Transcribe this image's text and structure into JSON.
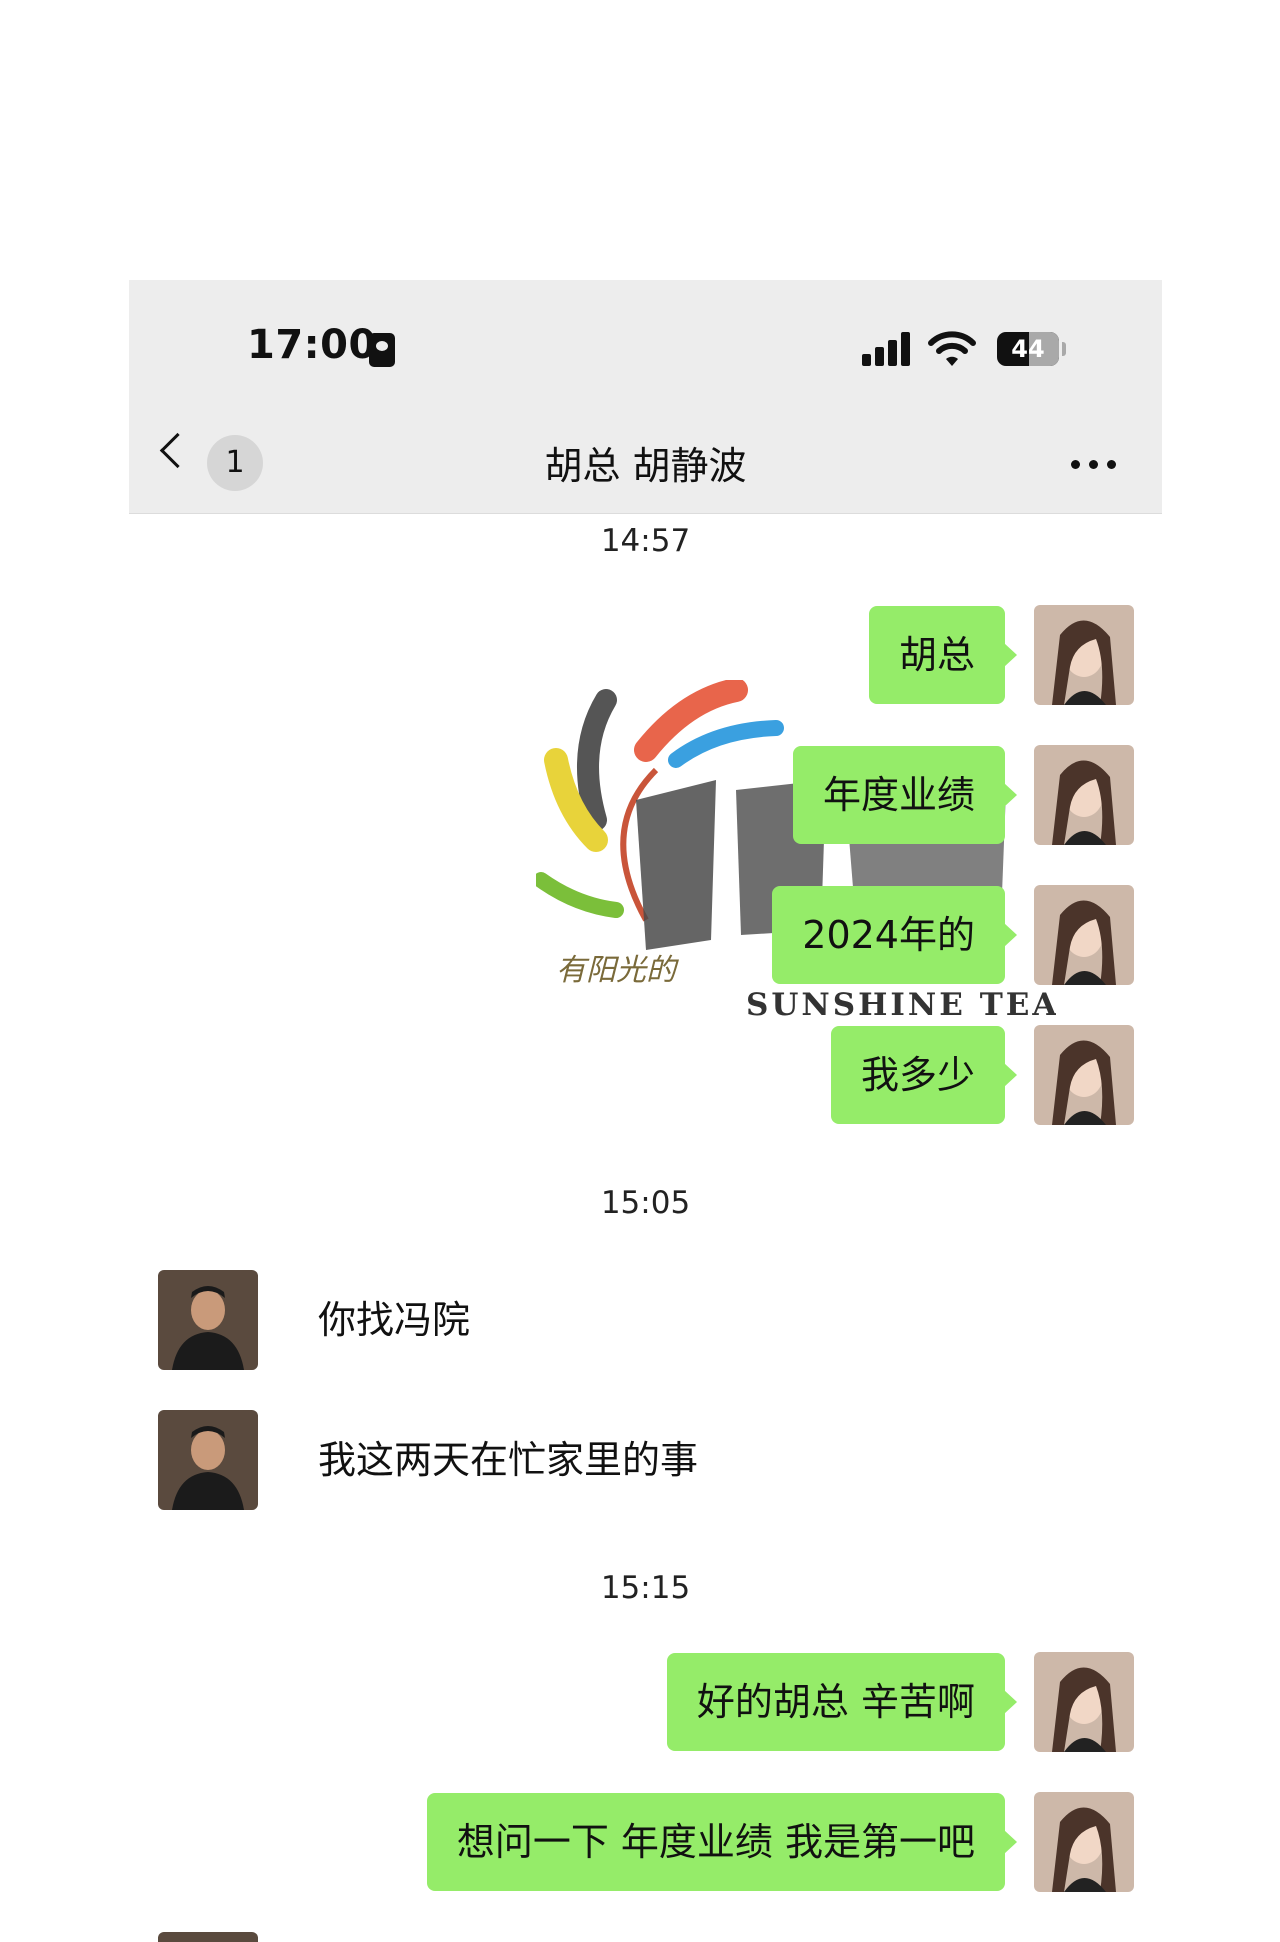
{
  "status_bar": {
    "time": "17:00",
    "battery": "44"
  },
  "nav": {
    "unread_count": "1",
    "title": "胡总 胡静波"
  },
  "watermark": {
    "line_cn": "有阳光的",
    "line_en": "SUNSHINE TEAM"
  },
  "messages": {
    "ts1": "14:57",
    "m1": "胡总",
    "m2": "年度业绩",
    "m3": "2024年的",
    "m4": "我多少",
    "ts2": "15:05",
    "m5": "你找冯院",
    "m6": "我这两天在忙家里的事",
    "ts3": "15:15",
    "m7": "好的胡总 辛苦啊",
    "m8": "想问一下  年度业绩 我是第一吧"
  },
  "colors": {
    "outgoing_bubble": "#95ec69",
    "header_bg": "#ededed"
  },
  "icons": [
    "back-chevron-icon",
    "sim-card-icon",
    "signal-icon",
    "wifi-icon",
    "battery-icon",
    "more-icon"
  ]
}
